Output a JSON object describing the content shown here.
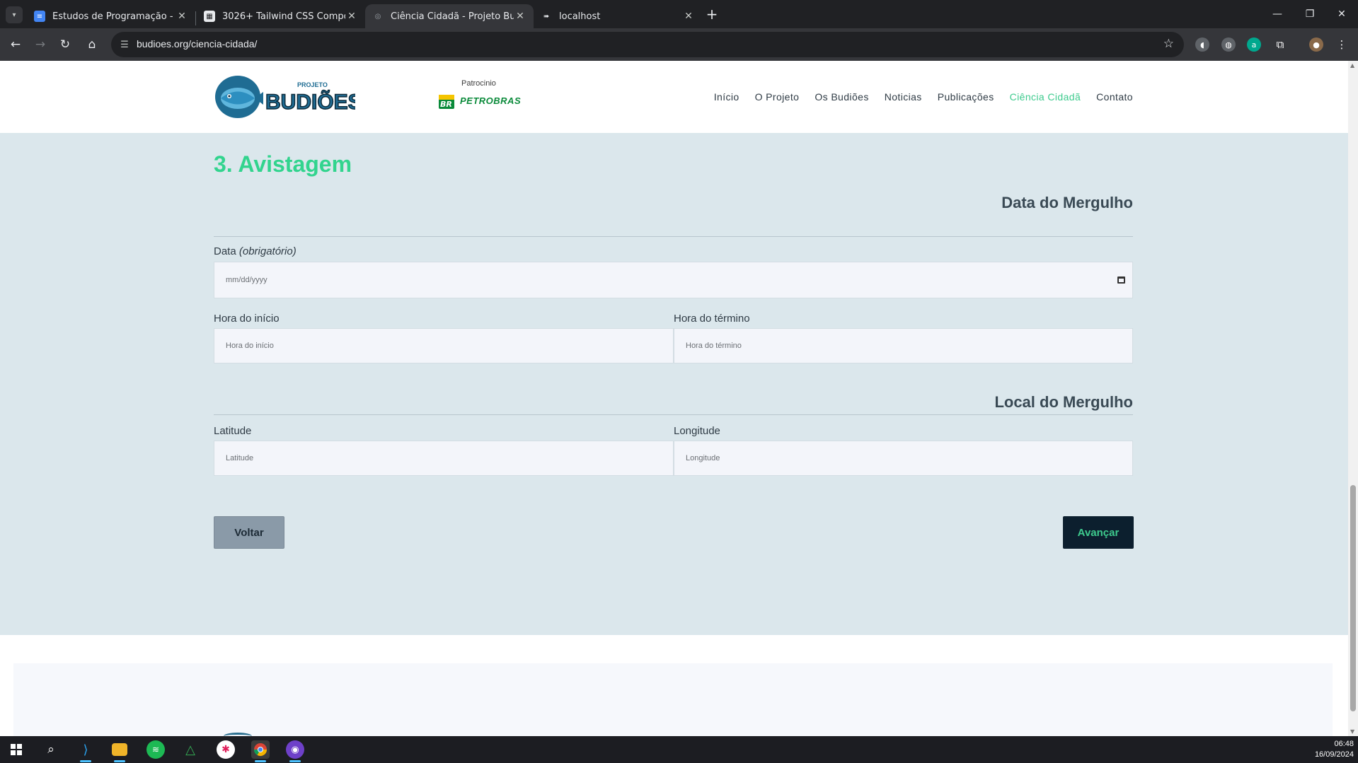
{
  "browser": {
    "tabs": [
      {
        "title": "Estudos de Programação - Mes",
        "icon": "docs-icon"
      },
      {
        "title": "3026+ Tailwind CSS Componen",
        "icon": "tailwind-components-icon"
      },
      {
        "title": "Ciência Cidadã - Projeto Budiõe",
        "icon": "budioes-favicon"
      },
      {
        "title": "localhost",
        "icon": "localhost-icon"
      }
    ],
    "url": "budioes.org/ciencia-cidada/"
  },
  "site": {
    "logo_top": "PROJETO",
    "logo_main": "BUDIÕES",
    "sponsor_label": "Patrocinio",
    "sponsor_mark": "BR",
    "sponsor_name": "PETROBRAS",
    "nav": [
      "Início",
      "O Projeto",
      "Os Budiões",
      "Noticias",
      "Publicações",
      "Ciência Cidadã",
      "Contato"
    ]
  },
  "form": {
    "section_title": "3. Avistagem",
    "dive_date_title": "Data do Mergulho",
    "date_label": "Data",
    "date_required": "(obrigatório)",
    "date_placeholder": "mm/dd/yyyy",
    "start_label": "Hora do início",
    "start_placeholder": "Hora do início",
    "end_label": "Hora do término",
    "end_placeholder": "Hora do término",
    "dive_location_title": "Local do Mergulho",
    "lat_label": "Latitude",
    "lat_placeholder": "Latitude",
    "lon_label": "Longitude",
    "lon_placeholder": "Longitude",
    "back_label": "Voltar",
    "next_label": "Avançar"
  },
  "taskbar": {
    "time": "06:48",
    "date": "16/09/2024"
  },
  "colors": {
    "accent_green": "#32d48e",
    "section_bg": "#dbe7ec",
    "button_dark": "#0c1f2e"
  }
}
